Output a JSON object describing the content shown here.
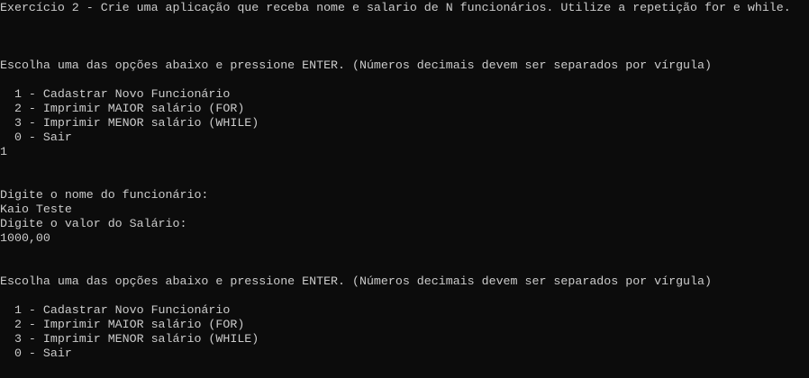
{
  "title": "Exercício 2 - Crie uma aplicação que receba nome e salario de N funcionários. Utilize a repetição for e while.",
  "prompt": "Escolha uma das opções abaixo e pressione ENTER. (Números decimais devem ser separados por vírgula)",
  "menu": [
    "  1 - Cadastrar Novo Funcionário",
    "  2 - Imprimir MAIOR salário (FOR)",
    "  3 - Imprimir MENOR salário (WHILE)",
    "  0 - Sair"
  ],
  "user_choice": "1",
  "name_prompt": "Digite o nome do funcionário:",
  "name_value": "Kaio Teste",
  "salary_prompt": "Digite o valor do Salário:",
  "salary_value": "1000,00"
}
